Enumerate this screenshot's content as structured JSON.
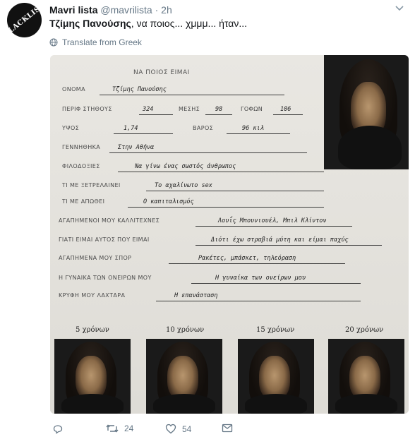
{
  "tweet": {
    "avatar_text": "BLACKLIST",
    "name": "Mavri lista",
    "handle": "@mavrilista",
    "separator": "·",
    "time": "2h",
    "mention": "Τζίμης Πανούσης",
    "text": ", να ποιος... χμμμ... ήταν...",
    "translate_label": "Translate from Greek"
  },
  "form": {
    "title": "ΝΑ  ΠΟΙΟΣ  ΕΙΜΑΙ",
    "rows": [
      {
        "label": "ΟΝΟΜΑ",
        "value": "Τζίμης Πανούσης"
      },
      {
        "label": "ΠΕΡΙΦ   ΣΤΗΘΟΥΣ",
        "value": "324",
        "label2": "ΜΕΣΗΣ",
        "value2": "98",
        "label3": "ΓΟΦΩΝ",
        "value3": "106"
      },
      {
        "label": "ΥΨΟΣ",
        "value": "1,74",
        "label2": "ΒΑΡΟΣ",
        "value2": "96 κιλ"
      },
      {
        "label": "ΓΕΝΝΗΘΗΚΑ",
        "value": "Στην Αθήνα"
      },
      {
        "label": "ΦΙΛΟΔΟΞΙΕΣ",
        "value": "Να γίνω ένας σωστός άνθρωπος"
      },
      {
        "label": "ΤΙ ΜΕ ΞΕΤΡΕΛΑΙΝΕΙ",
        "value": "Το αχαλίνωτο sex"
      },
      {
        "label": "ΤΙ ΜΕ ΑΠΩΘΕΙ",
        "value": "Ο καπιταλισμός"
      },
      {
        "label": "ΑΓΑΠΗΜΕΝΟΙ ΜΟΥ ΚΑΛΛΙΤΕΧΝΕΣ",
        "value": "Λουΐς Μπουνιουέλ, Μπιλ Κλίντον"
      },
      {
        "label": "ΓΙΑΤΙ ΕΙΜΑΙ ΑΥΤΟΣ ΠΟΥ ΕΙΜΑΙ",
        "value": "Διότι έχω στραβιά μύτη και είμαι παχύς"
      },
      {
        "label": "ΑΓΑΠΗΜΕΝΑ ΜΟΥ ΣΠΟΡ",
        "value": "Ρακέτες, μπάσκετ, τηλεόραση"
      },
      {
        "label": "Η ΓΥΝΑΙΚΑ ΤΩΝ ΟΝΕΙΡΩΝ ΜΟΥ",
        "value": "Η γυναίκα των ονείρων μου"
      },
      {
        "label": "ΚΡΥΦΗ ΜΟΥ ΛΑΧΤΑΡΑ",
        "value": "Η επανάσταση"
      }
    ],
    "ages": [
      "5 χρόνων",
      "10 χρόνων",
      "15 χρόνων",
      "20 χρόνων"
    ]
  },
  "actions": {
    "reply_icon": "reply-icon",
    "retweet_icon": "retweet-icon",
    "retweet_count": "24",
    "like_icon": "heart-icon",
    "like_count": "54",
    "dm_icon": "envelope-icon"
  },
  "colors": {
    "text": "#14171a",
    "muted": "#657786"
  }
}
